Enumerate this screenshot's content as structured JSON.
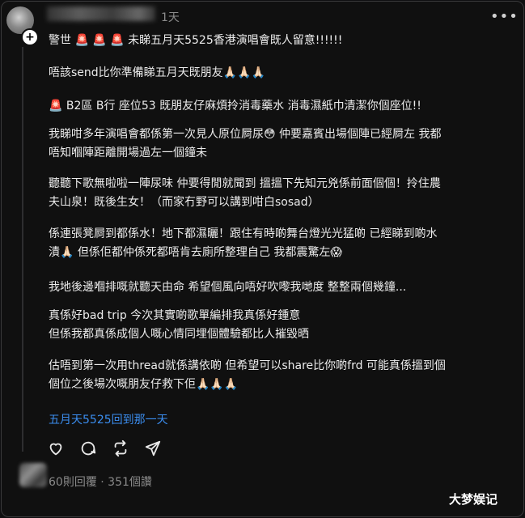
{
  "post": {
    "time": "1天",
    "more_label": "•••",
    "paragraphs": [
      "警世 🚨 🚨 🚨 未睇五月天5525香港演唱會既人留意!!!!!!",
      "唔該send比你準備睇五月天既朋友🙏🏻🙏🏻🙏🏻",
      "🚨 B2區 B行 座位53 既朋友仔麻煩拎消毒藥水 消毒濕紙巾清潔你個座位!!",
      "我睇咁多年演唱會都係第一次見人原位屙尿😳 仲要嘉賓出場個陣已經屙左 我都\n唔知嗰陣距離開場過左一個鐘未",
      "聽聽下歌無啦啦一陣尿味 仲要得閒就聞到 搵搵下先知元兇係前面個個！拎住農\n夫山泉！既後生女！（而家冇野可以講到咁白sosad）",
      "係連張凳屙到都係水！地下都濕曬！跟住有時啲舞台燈光光猛啲 已經睇到啲水\n漬🙏🏻 但係佢都仲係死都唔肯去廁所整理自己 我都震驚左😱",
      "我地後邊嗰排嘅就聽天由命 希望個風向唔好吹嚟我哋度 整整兩個幾鐘...",
      "真係好bad trip 今次其實啲歌單編排我真係好鍾意\n但係我都真係成個人嘅心情同埋個體驗都比人摧毀晒",
      "估唔到第一次用thread就係講依啲 但希望可以share比你啲frd 可能真係搵到個\n個位之後場次嘅朋友仔救下佢🙏🏻🙏🏻🙏🏻"
    ],
    "tag_link": "五月天5525回到那一天",
    "stats": "60則回覆 · 351個讚"
  },
  "actions": [
    "like-icon",
    "comment-icon",
    "repost-icon",
    "share-icon"
  ],
  "watermark": "大梦娱记",
  "colors": {
    "background": "#101010",
    "link": "#3b8ef0",
    "muted": "#8a8a8a"
  }
}
